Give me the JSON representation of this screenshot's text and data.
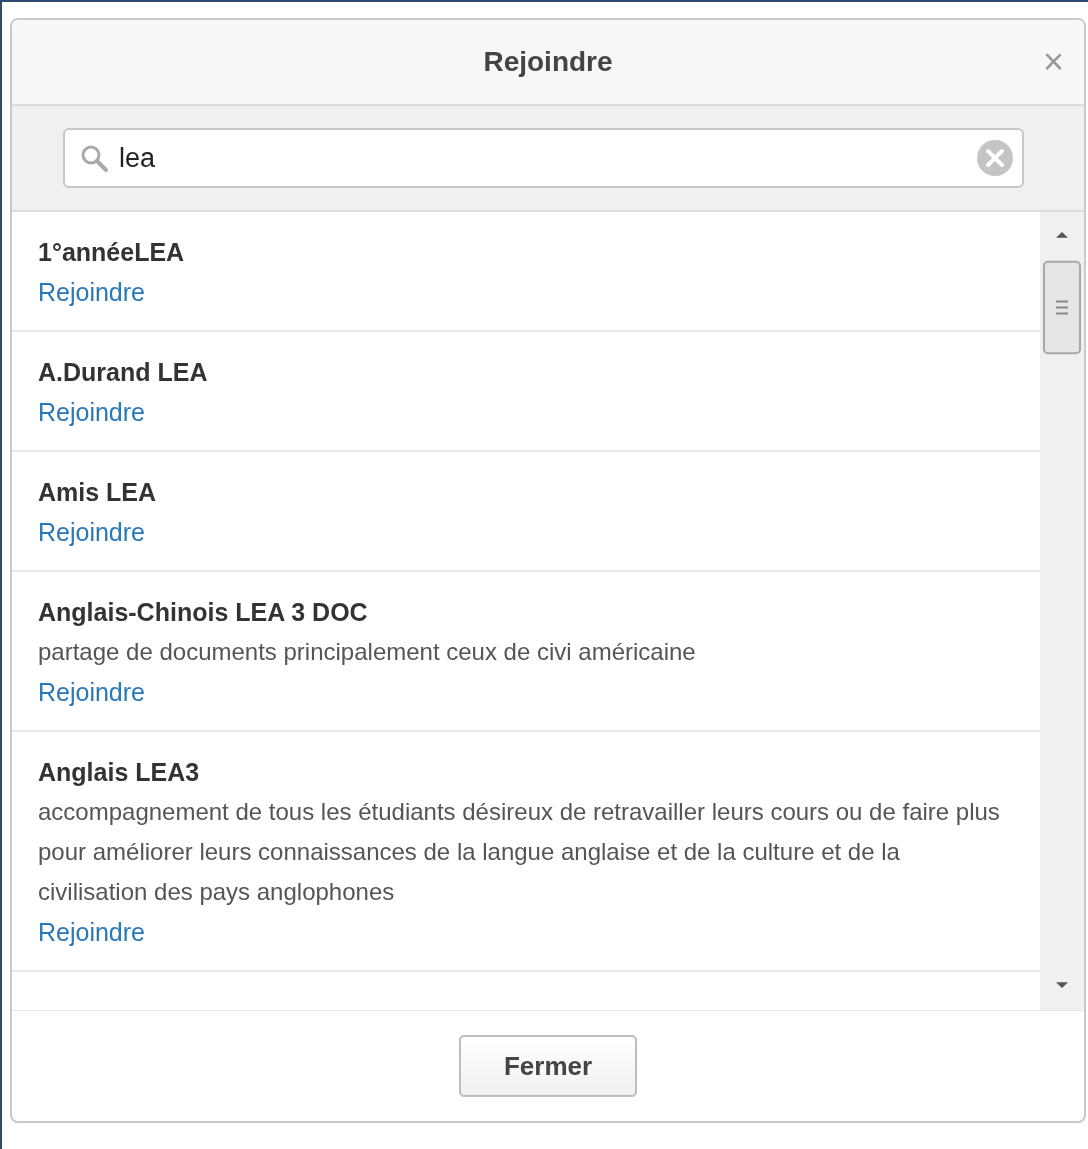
{
  "dialog": {
    "title": "Rejoindre",
    "close": "×"
  },
  "search": {
    "value": "lea"
  },
  "results": [
    {
      "name": "1°annéeLEA",
      "action": "Rejoindre"
    },
    {
      "name": "A.Durand LEA",
      "action": "Rejoindre"
    },
    {
      "name": "Amis LEA",
      "action": "Rejoindre"
    },
    {
      "name": "Anglais-Chinois LEA 3 DOC",
      "description": "partage de documents principalement ceux de civi américaine",
      "action": "Rejoindre"
    },
    {
      "name": "Anglais LEA3",
      "description": "accompagnement de tous les étudiants désireux de retravailler leurs cours ou de faire plus pour améliorer leurs connaissances de la langue anglaise et de la culture et de la civilisation des pays anglophones",
      "action": "Rejoindre"
    }
  ],
  "buttons": [
    "Fermer"
  ]
}
